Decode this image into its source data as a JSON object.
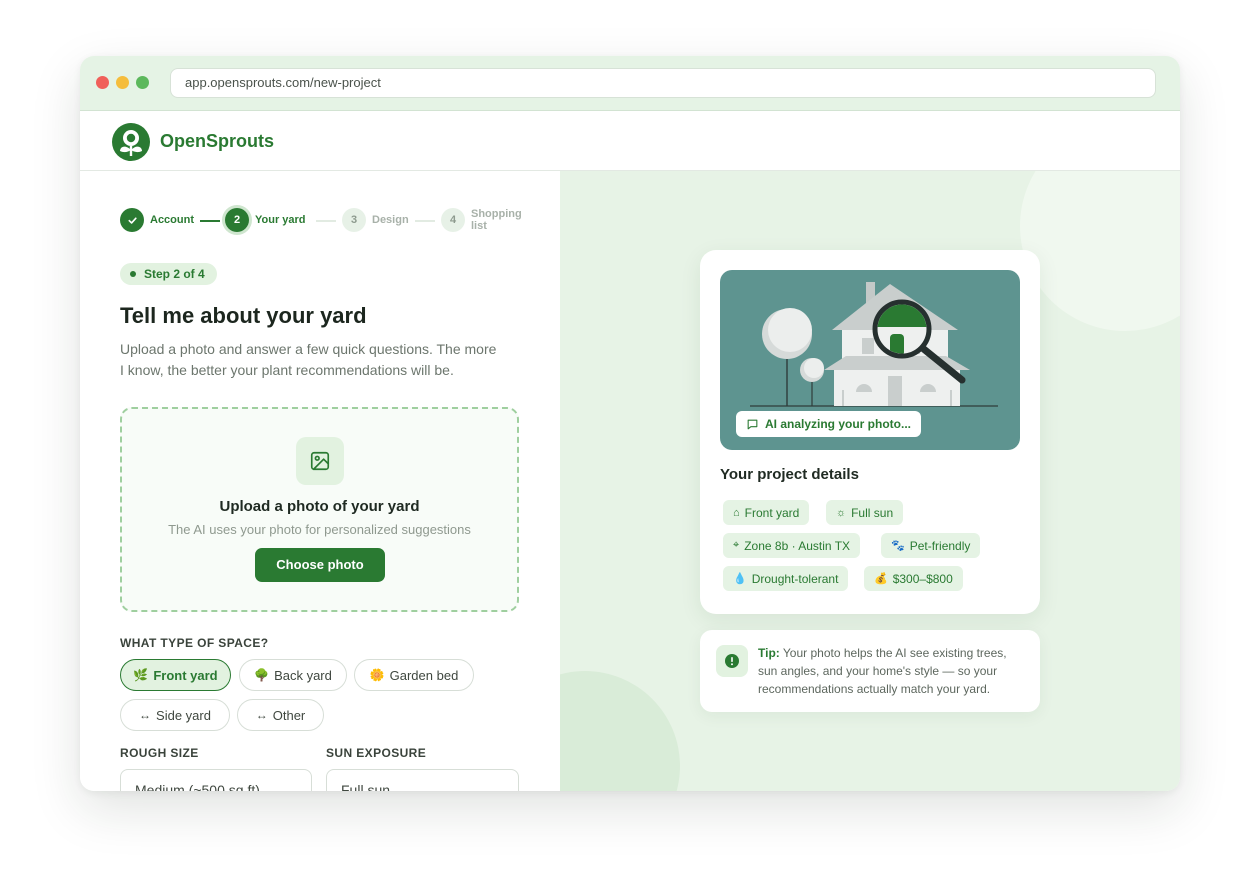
{
  "browser": {
    "url": "app.opensprouts.com/new-project"
  },
  "brand": {
    "name": "OpenSprouts",
    "accent": "#2a7a32"
  },
  "stepper": {
    "steps": [
      {
        "number": "1",
        "label": "Account",
        "state": "done"
      },
      {
        "number": "2",
        "label": "Your yard",
        "state": "active"
      },
      {
        "number": "3",
        "label": "Design",
        "state": "todo"
      },
      {
        "number": "4",
        "label": "Shopping list",
        "state": "todo"
      }
    ]
  },
  "form": {
    "step_pill": "Step 2 of 4",
    "title": "Tell me about your yard",
    "subtitle": "Upload a photo and answer a few quick questions. The more I know, the better your plant recommendations will be.",
    "upload": {
      "title": "Upload a photo of your yard",
      "subtitle": "The AI uses your photo for personalized suggestions",
      "button": "Choose photo",
      "icon": "image-icon"
    },
    "space": {
      "label": "WHAT TYPE OF SPACE?",
      "options": [
        {
          "label": "Front yard",
          "icon": "sprout-icon",
          "selected": true
        },
        {
          "label": "Back yard",
          "icon": "tree-icon",
          "selected": false
        },
        {
          "label": "Garden bed",
          "icon": "flower-icon",
          "selected": false
        },
        {
          "label": "Side yard",
          "icon": "arrows-icon",
          "selected": false
        },
        {
          "label": "Other",
          "icon": "arrows-icon",
          "selected": false
        }
      ]
    },
    "size": {
      "label": "ROUGH SIZE",
      "value": "Medium (~500 sq ft)"
    },
    "sun": {
      "label": "SUN EXPOSURE",
      "value": "Full sun"
    }
  },
  "preview": {
    "ai_badge": "AI analyzing your photo...",
    "details_title": "Your project details",
    "tags": [
      {
        "label": "Front yard",
        "icon": "home-icon"
      },
      {
        "label": "Full sun",
        "icon": "sun-icon"
      },
      {
        "label": "Zone 8b · Austin TX",
        "icon": "location-icon"
      },
      {
        "label": "Pet-friendly",
        "icon": "paw-icon"
      },
      {
        "label": "Drought-tolerant",
        "icon": "droplet-icon"
      },
      {
        "label": "$300–$800",
        "icon": "money-bag-icon"
      }
    ],
    "tip": {
      "label": "Tip:",
      "text": " Your photo helps the AI see existing trees, sun angles, and your home's style — so your recommendations actually match your yard."
    }
  }
}
